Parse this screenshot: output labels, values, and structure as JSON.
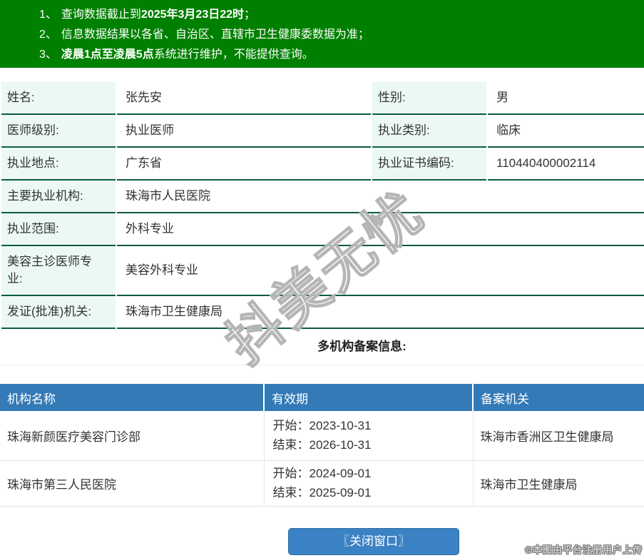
{
  "notice": {
    "items": [
      {
        "num": "1、",
        "pre": "查询数据截止到",
        "bold": "2025年3月23日22时",
        "post": "；"
      },
      {
        "num": "2、",
        "pre": "信息数据结果以各省、自治区、直辖市卫生健康委数据为准；",
        "bold": "",
        "post": ""
      },
      {
        "num": "3、",
        "pre": "",
        "bold": "凌晨1点至凌晨5点",
        "post": "系统进行维护，不能提供查询。"
      }
    ]
  },
  "profile": {
    "row1": {
      "label1": "姓名:",
      "value1": "张先安",
      "label2": "性别:",
      "value2": "男"
    },
    "row2": {
      "label1": "医师级别:",
      "value1": "执业医师",
      "label2": "执业类别:",
      "value2": "临床"
    },
    "row3": {
      "label1": "执业地点:",
      "value1": "广东省",
      "label2": "执业证书编码:",
      "value2": "110440400002114"
    },
    "row4": {
      "label1": "主要执业机构:",
      "value1": "珠海市人民医院"
    },
    "row5": {
      "label1": "执业范围:",
      "value1": "外科专业"
    },
    "row6": {
      "label1": "美容主诊医师专业:",
      "value1": "美容外科专业"
    },
    "row7": {
      "label1": "发证(批准)机关:",
      "value1": "珠海市卫生健康局"
    }
  },
  "records": {
    "title": "多机构备案信息:",
    "headers": [
      "机构名称",
      "有效期",
      "备案机关"
    ],
    "rows": [
      {
        "name": "珠海新颜医疗美容门诊部",
        "valid_start": "开始：2023-10-31",
        "valid_end": "结束：2026-10-31",
        "authority": "珠海市香洲区卫生健康局"
      },
      {
        "name": "珠海市第三人民医院",
        "valid_start": "开始：2024-09-01",
        "valid_end": "结束：2025-09-01",
        "authority": "珠海市卫生健康局"
      }
    ]
  },
  "footer": {
    "close_button": "〖关闭窗口〗",
    "copyright": "©本图由平台注册用户上传"
  },
  "watermark": {
    "text": "抖美无忧"
  },
  "colors": {
    "notice_bg": "#008000",
    "table_header_bg": "#337ab7",
    "button_bg": "#3b82c4",
    "label_cell_bg": "#ecf9f2",
    "profile_border": "#0b5c41"
  }
}
